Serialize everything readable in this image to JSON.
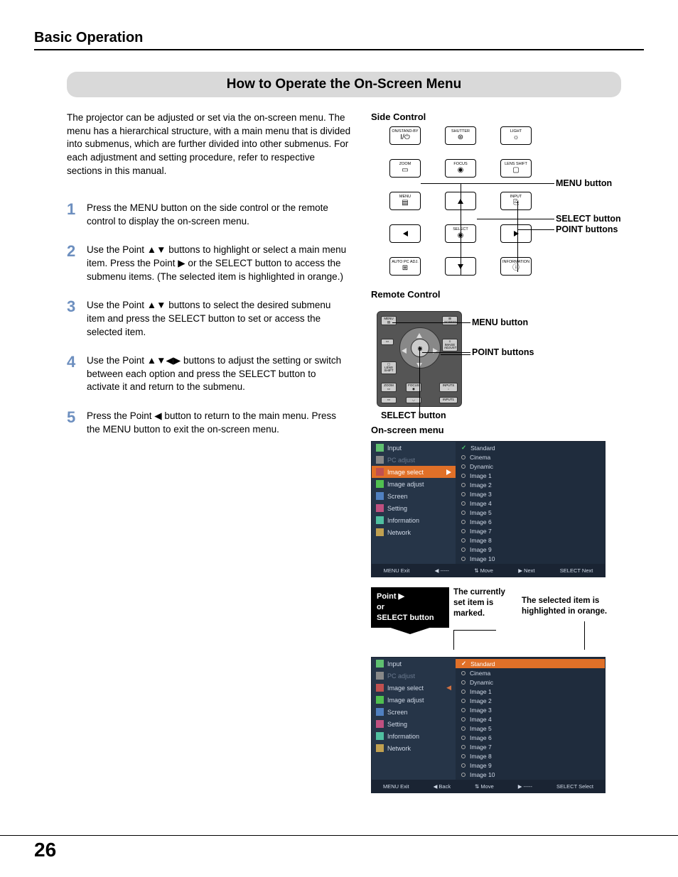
{
  "header": "Basic Operation",
  "title": "How to Operate the On-Screen Menu",
  "intro": "The projector can be adjusted or set via the on-screen menu. The menu has a hierarchical structure, with a main menu that is divided into submenus, which are further divided into other submenus. For each adjustment and setting procedure, refer to respective sections in this manual.",
  "steps": [
    "Press the MENU button on the side control or the remote control to display the on-screen menu.",
    "Use the Point ▲▼ buttons to highlight or select a main menu item. Press the Point ▶ or the SELECT button to access the submenu items. (The selected item is highlighted in orange.)",
    "Use the Point ▲▼ buttons to select the desired submenu item and press the SELECT button to set or access the selected item.",
    "Use the Point ▲▼◀▶ buttons to adjust the setting or switch between each option and press the SELECT button to activate it and return to the submenu.",
    "Press the Point ◀ button to return to the main menu. Press the MENU button to exit the on-screen menu."
  ],
  "side_control": {
    "title": "Side Control",
    "buttons": {
      "r1": [
        "ON/STAND-BY",
        "SHUTTER",
        "LIGHT"
      ],
      "r2": [
        "ZOOM",
        "FOCUS",
        "LENS SHIFT"
      ],
      "r3": [
        "MENU",
        "",
        "INPUT"
      ],
      "select": "SELECT",
      "r5": [
        "AUTO PC ADJ.",
        "INFORMATION"
      ]
    },
    "annots": {
      "menu": "MENU button",
      "select": "SELECT button",
      "point": "POINT buttons"
    }
  },
  "remote": {
    "title": "Remote Control",
    "labels": {
      "menu": "MENU",
      "lens_shift": "LENS SHIFT",
      "zoom": "ZOOM",
      "focus": "FOCUS",
      "image_adjust": "IMAGE ADJUST",
      "screen": "SCREEN",
      "input1": "INPUT1",
      "inputs": "INPUTS"
    },
    "annot_menu": "MENU button",
    "annot_point": "POINT buttons",
    "annot_select": "SELECT button"
  },
  "osm": {
    "title": "On-screen menu",
    "main_items": [
      "Input",
      "PC adjust",
      "Image select",
      "Image adjust",
      "Screen",
      "Setting",
      "Information",
      "Network"
    ],
    "sub_items": [
      "Standard",
      "Cinema",
      "Dynamic",
      "Image 1",
      "Image 2",
      "Image 3",
      "Image 4",
      "Image 5",
      "Image 6",
      "Image 7",
      "Image 8",
      "Image 9",
      "Image 10"
    ],
    "highlighted_main": "Image select",
    "highlighted_sub": "Standard",
    "footer1": [
      "MENU Exit",
      "◀ -----",
      "⇅ Move",
      "▶ Next",
      "SELECT Next"
    ],
    "footer2": [
      "MENU Exit",
      "◀ Back",
      "⇅ Move",
      "▶ -----",
      "SELECT Select"
    ]
  },
  "annot_block": {
    "left": "Point ▶\nor\nSELECT button",
    "mid": "The currently set item is marked.",
    "right": "The selected item is highlighted in orange."
  },
  "page_number": "26"
}
